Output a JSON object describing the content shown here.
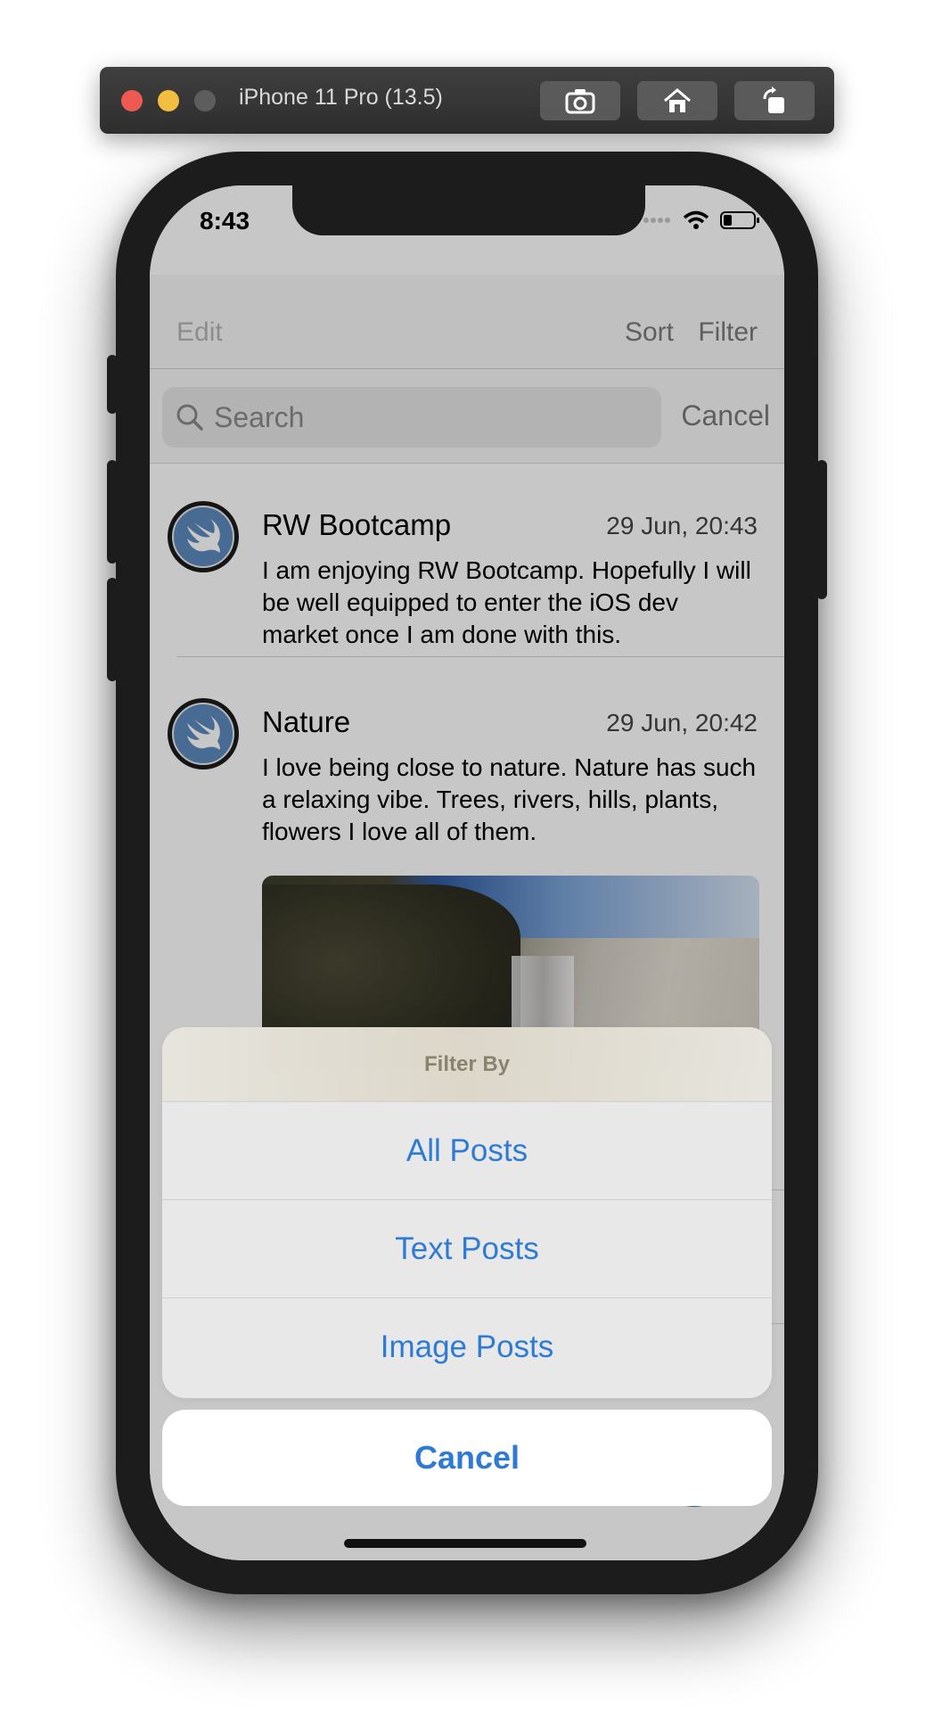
{
  "simulator": {
    "device_title": "iPhone 11 Pro (13.5)",
    "buttons": [
      "screenshot-icon",
      "home-icon",
      "rotate-icon"
    ]
  },
  "status_bar": {
    "time": "8:43"
  },
  "nav": {
    "edit_label": "Edit",
    "sort_label": "Sort",
    "filter_label": "Filter"
  },
  "search": {
    "placeholder": "Search",
    "cancel_label": "Cancel"
  },
  "posts": [
    {
      "title": "RW Bootcamp",
      "date": "29 Jun, 20:43",
      "body": "I am enjoying RW Bootcamp. Hopefully I will be well equipped to enter the iOS dev market once I am done with this."
    },
    {
      "title": "Nature",
      "date": "29 Jun, 20:42",
      "body": "I love being close to nature. Nature has such a relaxing vibe. Trees, rivers, hills, plants, flowers I love all of them."
    }
  ],
  "action_sheet": {
    "title": "Filter By",
    "options": [
      "All Posts",
      "Text Posts",
      "Image Posts"
    ],
    "cancel_label": "Cancel"
  },
  "colors": {
    "accent": "#2e7bd6",
    "avatar": "#5d89bd"
  }
}
